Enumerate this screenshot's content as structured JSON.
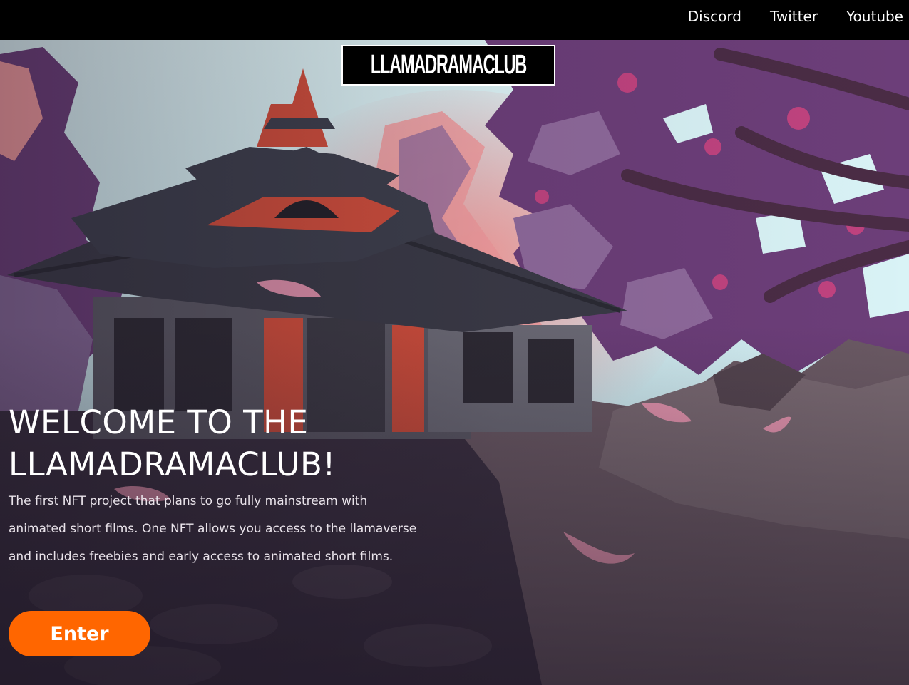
{
  "nav": {
    "links": [
      "Discord",
      "Twitter",
      "Youtube"
    ]
  },
  "logo": {
    "text": "LLAMADRAMACLUB"
  },
  "hero": {
    "title": "WELCOME TO THE LLAMADRAMACLUB!",
    "description": "The first NFT project that plans to go fully mainstream with animated short films. One NFT allows you access to the llamaverse and includes freebies and early access to animated short films.",
    "enter_label": "Enter"
  },
  "colors": {
    "enter_button": "#ff6600",
    "topbar": "#000000",
    "sky": "#dcf5f7",
    "blossom": "#6b3d77",
    "temple_red": "#d24e3b"
  }
}
